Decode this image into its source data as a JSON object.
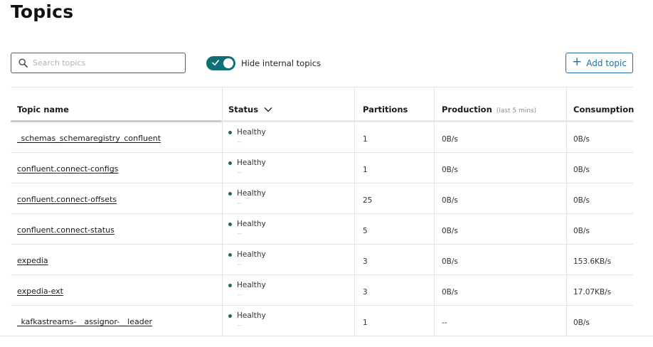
{
  "page": {
    "title": "Topics"
  },
  "search": {
    "placeholder": "Search topics",
    "value": ""
  },
  "toggle": {
    "label": "Hide internal topics",
    "checked": true,
    "color": "#0e6f74"
  },
  "add_button": {
    "label": "Add topic",
    "icon": "plus-icon"
  },
  "table": {
    "columns": {
      "name": "Topic name",
      "status": "Status",
      "partitions": "Partitions",
      "production": "Production",
      "production_sub": "(last 5 mins)",
      "consumption": "Consumption"
    },
    "rows": [
      {
        "name": "_schemas_schemaregistry_confluent",
        "status": "Healthy",
        "status_sub": "--",
        "partitions": "1",
        "production": "0B/s",
        "consumption": "0B/s"
      },
      {
        "name": "confluent.connect-configs",
        "status": "Healthy",
        "status_sub": "--",
        "partitions": "1",
        "production": "0B/s",
        "consumption": "0B/s"
      },
      {
        "name": "confluent.connect-offsets",
        "status": "Healthy",
        "status_sub": "--",
        "partitions": "25",
        "production": "0B/s",
        "consumption": "0B/s"
      },
      {
        "name": "confluent.connect-status",
        "status": "Healthy",
        "status_sub": "--",
        "partitions": "5",
        "production": "0B/s",
        "consumption": "0B/s"
      },
      {
        "name": "expedia",
        "status": "Healthy",
        "status_sub": "--",
        "partitions": "3",
        "production": "0B/s",
        "consumption": "153.6KB/s"
      },
      {
        "name": "expedia-ext",
        "status": "Healthy",
        "status_sub": "--",
        "partitions": "3",
        "production": "0B/s",
        "consumption": "17.07KB/s"
      },
      {
        "name": "_kafkastreams-__assignor-__leader",
        "status": "Healthy",
        "status_sub": "--",
        "partitions": "1",
        "production": "--",
        "consumption": "0B/s"
      }
    ]
  },
  "colors": {
    "accent": "#1e6fa8",
    "healthy": "#1f6b4a"
  }
}
